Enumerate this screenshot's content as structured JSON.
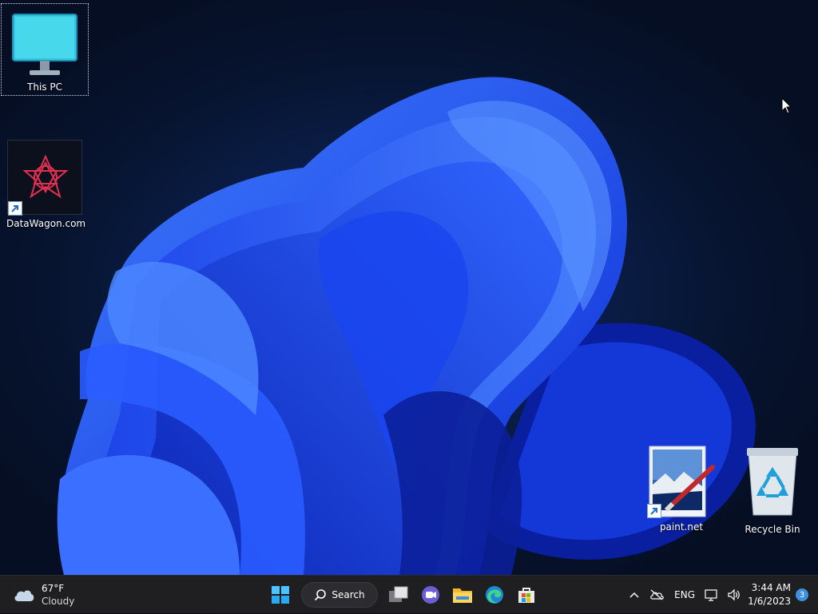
{
  "desktop": {
    "icons": [
      {
        "label": "This PC",
        "icon": "monitor-icon"
      },
      {
        "label": "DataWagon.com",
        "icon": "datawagon-logo-icon"
      },
      {
        "label": "paint.net",
        "icon": "paintnet-icon"
      },
      {
        "label": "Recycle Bin",
        "icon": "recycle-bin-icon"
      }
    ]
  },
  "taskbar": {
    "weather": {
      "temp": "67°F",
      "condition": "Cloudy",
      "icon": "cloud-icon"
    },
    "search_label": "Search",
    "apps": [
      "start-icon",
      "search-icon",
      "task-view-icon",
      "teams-chat-icon",
      "file-explorer-icon",
      "edge-icon",
      "microsoft-store-icon"
    ],
    "tray": {
      "language": "ENG",
      "time": "3:44 AM",
      "date": "1/6/2023",
      "notifications": "3"
    }
  },
  "colors": {
    "accent": "#1f5cff",
    "taskbar": "#1f1f22",
    "badge": "#3f8ee0"
  }
}
